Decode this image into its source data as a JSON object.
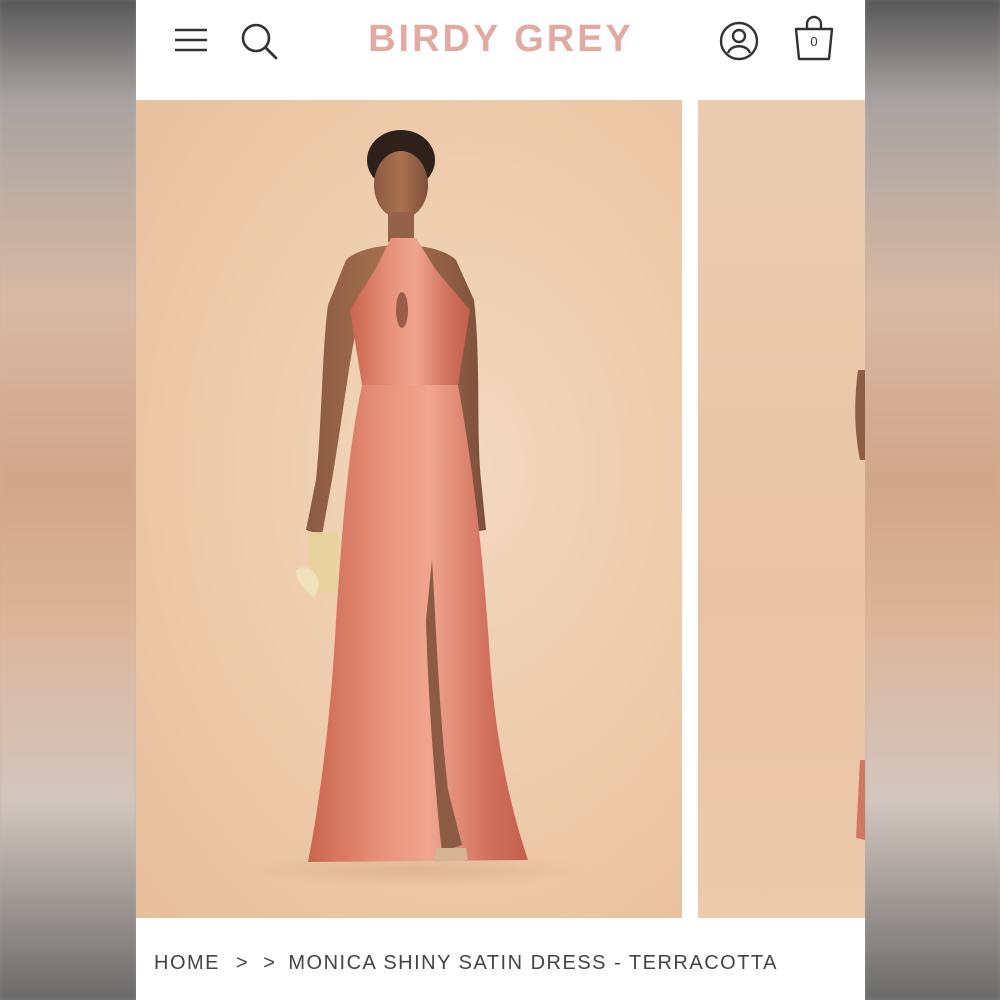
{
  "header": {
    "brand": "BIRDY GREY",
    "cart_count": "0",
    "menu_icon": "hamburger-menu-icon",
    "search_icon": "search-icon",
    "account_icon": "user-account-icon",
    "cart_icon": "shopping-bag-icon"
  },
  "gallery": {
    "current_slide": 1,
    "images": [
      {
        "description_icon": "product-photo"
      },
      {
        "description_icon": "product-photo"
      }
    ]
  },
  "breadcrumb": {
    "home": "HOME",
    "sep1": ">",
    "sep2": ">",
    "current": "MONICA SHINY SATIN DRESS - TERRACOTTA"
  },
  "colors": {
    "brand": "#e3aaa1",
    "dress": "#d9806a",
    "backdrop": "#edcaa9"
  }
}
